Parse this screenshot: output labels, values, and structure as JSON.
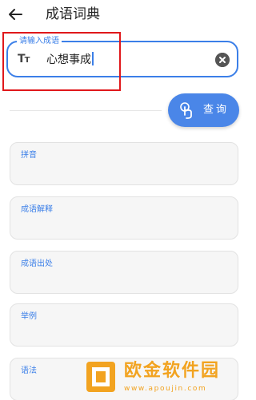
{
  "app_bar": {
    "title": "成语词典",
    "back_icon": "arrow-left-icon"
  },
  "search": {
    "legend": "请输入成语",
    "value": "心想事成",
    "leading_icon": "text-size-icon",
    "trailing_icon": "clear-icon"
  },
  "query_button": {
    "label": "查询",
    "icon": "touch-icon"
  },
  "fields": [
    {
      "label": "拼音"
    },
    {
      "label": "成语解释"
    },
    {
      "label": "成语出处"
    },
    {
      "label": "举例"
    },
    {
      "label": "语法"
    }
  ],
  "watermark": {
    "title": "欧金软件园",
    "url": "www.apoujin.com"
  },
  "colors": {
    "accent": "#3b7fe8",
    "button": "#4a86e8",
    "highlight": "#e0181b",
    "card_bg": "#f6f6f6",
    "watermark": "#f2a320"
  }
}
